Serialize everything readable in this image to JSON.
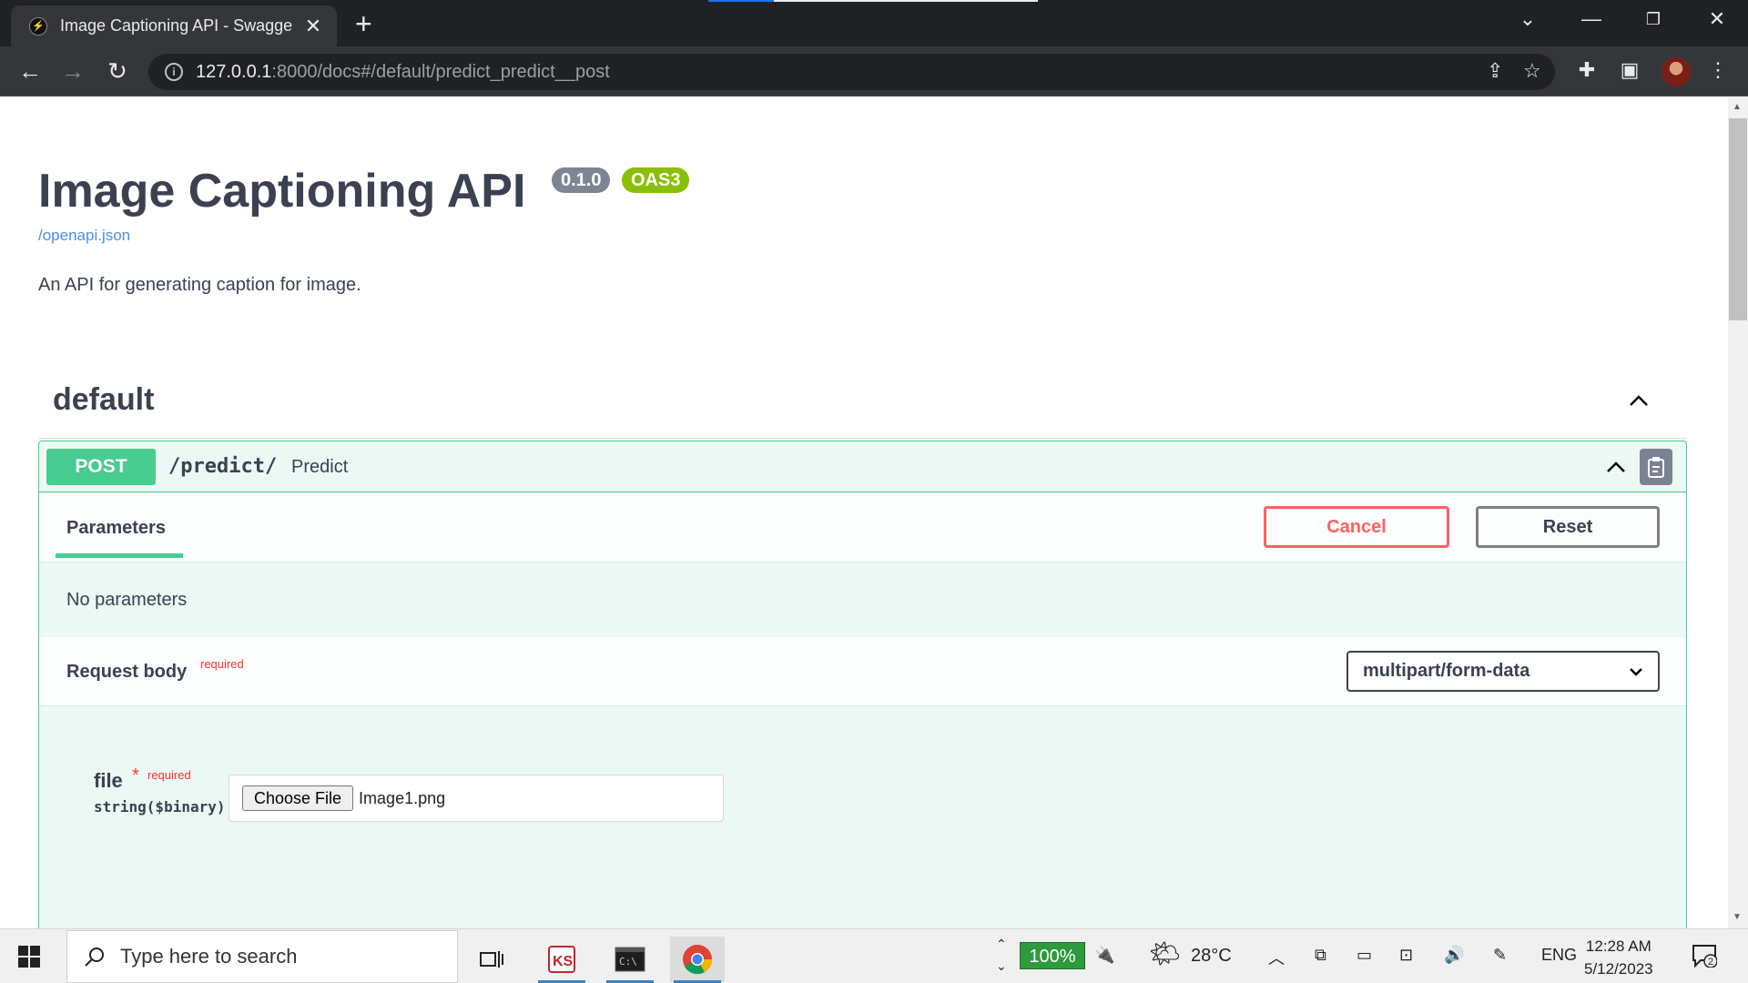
{
  "browser": {
    "tab_title": "Image Captioning API - Swagger UI",
    "url_host": "127.0.0.1",
    "url_rest": ":8000/docs#/default/predict_predict__post"
  },
  "api": {
    "title": "Image Captioning API",
    "version": "0.1.0",
    "oas": "OAS3",
    "openapi_link": "/openapi.json",
    "description": "An API for generating caption for image."
  },
  "section": {
    "title": "default"
  },
  "operation": {
    "method": "POST",
    "path": "/predict/",
    "summary": "Predict",
    "parameters_tab": "Parameters",
    "cancel_label": "Cancel",
    "reset_label": "Reset",
    "no_params": "No parameters",
    "request_body_label": "Request body",
    "required_label": "required",
    "content_type": "multipart/form-data",
    "param": {
      "name": "file",
      "star": "*",
      "required": "required",
      "type": "string($binary)",
      "choose_label": "Choose File",
      "file_name": "Image1.png"
    }
  },
  "taskbar": {
    "search_placeholder": "Type here to search",
    "battery": "100%",
    "temperature": "28°C",
    "language": "ENG",
    "time": "12:28 AM",
    "date": "5/12/2023",
    "notifications": "2"
  }
}
